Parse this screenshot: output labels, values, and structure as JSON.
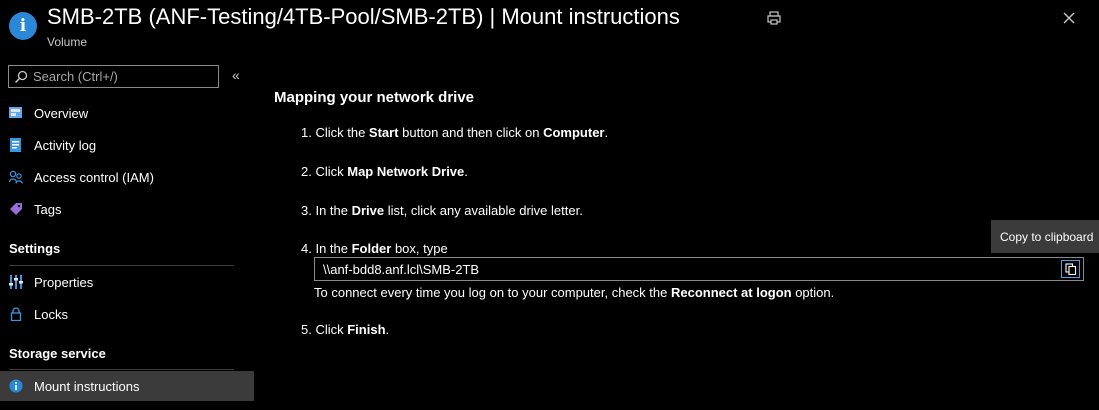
{
  "header": {
    "title": "SMB-2TB (ANF-Testing/4TB-Pool/SMB-2TB) | Mount instructions",
    "subtitle": "Volume",
    "info_glyph": "i",
    "icons": {
      "info": "info-icon",
      "print": "print-icon",
      "close": "close-icon"
    }
  },
  "sidebar": {
    "search_placeholder": "Search (Ctrl+/)",
    "collapse_glyph": "«",
    "items": [
      {
        "label": "Overview",
        "icon": "overview-icon"
      },
      {
        "label": "Activity log",
        "icon": "activity-log-icon"
      },
      {
        "label": "Access control (IAM)",
        "icon": "access-control-icon"
      },
      {
        "label": "Tags",
        "icon": "tag-icon"
      }
    ],
    "settings_header": "Settings",
    "settings_items": [
      {
        "label": "Properties",
        "icon": "properties-icon"
      },
      {
        "label": "Locks",
        "icon": "lock-icon"
      }
    ],
    "storage_header": "Storage service",
    "storage_items": [
      {
        "label": "Mount instructions",
        "icon": "info-icon",
        "active": true
      }
    ]
  },
  "main": {
    "title": "Mapping your network drive",
    "step1": {
      "a": "1. Click the ",
      "b": "Start",
      "c": " button and then click on ",
      "d": "Computer",
      "e": "."
    },
    "step2": {
      "a": "2. Click ",
      "b": "Map Network Drive",
      "c": "."
    },
    "step3": {
      "a": "3. In the ",
      "b": "Drive",
      "c": " list, click any available drive letter."
    },
    "step4": {
      "a": "4. In the ",
      "b": "Folder",
      "c": " box, type"
    },
    "folder_path": "\\\\anf-bdd8.anf.lcl\\SMB-2TB",
    "step4_note": {
      "a": "To connect every time you log on to your computer, check the ",
      "b": "Reconnect at logon",
      "c": " option."
    },
    "step5": {
      "a": "5. Click ",
      "b": "Finish",
      "c": "."
    }
  },
  "tooltip": {
    "text": "Copy to clipboard"
  },
  "colors": {
    "accent": "#2b88d8",
    "background": "#000000",
    "active_bg": "#3b3b3b",
    "copy_border": "#4aa3df"
  }
}
